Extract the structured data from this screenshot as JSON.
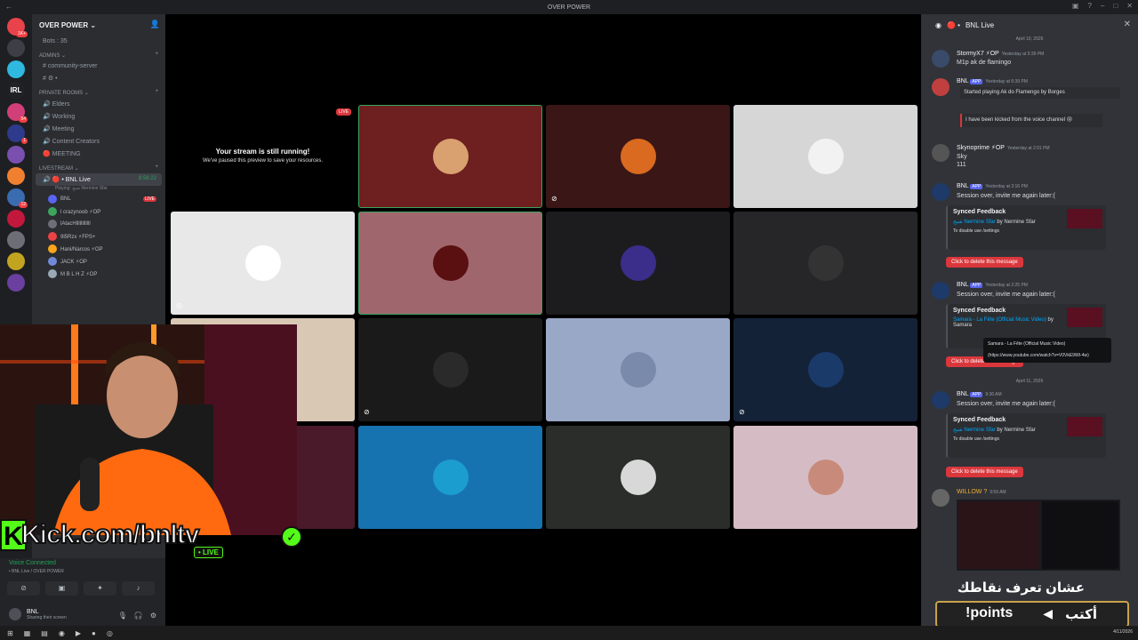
{
  "window": {
    "title": "OVER POWER"
  },
  "servers": [
    {
      "color": "#e8434b",
      "badge": "1K+"
    },
    {
      "color": "#3c3f45",
      "badge": ""
    },
    {
      "color": "#2fb8e0",
      "badge": ""
    },
    {
      "color": "#202225",
      "label": "IRL",
      "badge": ""
    },
    {
      "color": "#d13f7a",
      "badge": "54"
    },
    {
      "color": "#2e3a8c",
      "badge": "1"
    },
    {
      "color": "#7a4fb0",
      "badge": ""
    },
    {
      "color": "#f08030",
      "badge": ""
    },
    {
      "color": "#3a6cb0",
      "badge": "12"
    },
    {
      "color": "#c2183c",
      "badge": ""
    },
    {
      "color": "#6d6f78",
      "badge": ""
    },
    {
      "color": "#c2a420",
      "badge": ""
    },
    {
      "color": "#6a3fa0",
      "badge": ""
    }
  ],
  "sidebar": {
    "server_name": "OVER POWER",
    "bots_line": "Bots : 35",
    "admins_label": "ADMINS",
    "admins": [
      "community-server",
      "⚙ •"
    ],
    "private_label": "PRIVATE ROOMS",
    "private_rooms": [
      "Elders",
      "Working",
      "Meeting",
      "Content Creators",
      "MEETING"
    ],
    "livestream_label": "LIVESTREAM",
    "active_channel": "BNL Live",
    "active_time": "8:56:22",
    "active_sub": "Playing: شبح Nermine Sfar",
    "voice_users": [
      {
        "name": "BNL",
        "live": "LIVE",
        "color": "#5865f2"
      },
      {
        "name": "l crazynoob ⚡OP",
        "live": "",
        "color": "#3ba55d"
      },
      {
        "name": "lAtacHllllllllllll",
        "live": "",
        "color": "#6d6f78"
      },
      {
        "name": "9l5Rzx ⚡FPS+",
        "live": "",
        "color": "#ed4245"
      },
      {
        "name": "Hani/Narcos ⚡OP",
        "live": "",
        "color": "#faa61a"
      },
      {
        "name": "JACK ⚡OP",
        "live": "",
        "color": "#7289da"
      },
      {
        "name": "M B L H Z ⚡OP",
        "live": "",
        "color": "#99aab5"
      }
    ]
  },
  "voice_panel": {
    "status": "Voice Connected",
    "sub": "• BNL Live / OVER POWER",
    "user_name": "BNL",
    "user_status": "Sharing their screen"
  },
  "stage": {
    "live_badge": "LIVE",
    "paused_title": "Your stream is still running!",
    "paused_sub": "We've paused this preview to save your resources.",
    "tiles": [
      {
        "bg": "#6e1f1f",
        "avatar": "#d9a070",
        "border": "#3ba55d"
      },
      {
        "bg": "#3a1616",
        "avatar": "#d96a20",
        "border": ""
      },
      {
        "bg": "#d6d6d6",
        "avatar": "#f2f2f2",
        "border": ""
      },
      {
        "bg": "#e8e8e8",
        "avatar": "#ffffff",
        "border": ""
      },
      {
        "bg": "#a0666e",
        "avatar": "#5a1010",
        "border": "#3ba55d"
      },
      {
        "bg": "#1c1c1f",
        "avatar": "#3b2d8a",
        "border": ""
      },
      {
        "bg": "#262628",
        "avatar": "#333",
        "border": ""
      },
      {
        "bg": "#d9c8b4",
        "avatar": "",
        "border": ""
      },
      {
        "bg": "#1a1a1a",
        "avatar": "#2a2a2a",
        "border": ""
      },
      {
        "bg": "#9aa8c8",
        "avatar": "#7a8aaa",
        "border": ""
      },
      {
        "bg": "#142238",
        "avatar": "#1a3a6a",
        "border": ""
      },
      {
        "bg": "#4a1a2a",
        "avatar": "",
        "border": ""
      },
      {
        "bg": "#1773b0",
        "avatar": "#1b9dd0",
        "border": ""
      },
      {
        "bg": "#2a2d2a",
        "avatar": "#d8d8d8",
        "border": ""
      },
      {
        "bg": "#d5bcc4",
        "avatar": "#c88a7a",
        "border": ""
      }
    ]
  },
  "overlay": {
    "kick_url": "Kick.com/bnltv",
    "kick_live": "• LIVE",
    "points_arabic_top": "عشان تعرف نقاطك",
    "points_cmd": "!points",
    "points_arabic_write": "أكتب"
  },
  "chat": {
    "header": "BNL Live",
    "dates": [
      "April 10, 2026",
      "April 11, 2026"
    ],
    "messages": [
      {
        "name": "StormyX7",
        "tag": "⚡OP",
        "time": "Yesterday at 5:39 PM",
        "text": "M1p ak de flamingo",
        "avatar": "#3a4a6a"
      },
      {
        "name": "BNL",
        "tag": "APP",
        "time": "Yesterday at 6:39 PM",
        "text": "Started playing Ak do Flamengo by Borges",
        "avatar": "#c04040"
      },
      {
        "name": "",
        "tag": "",
        "time": "",
        "text": "I have been kicked from the voice channel 😢",
        "avatar": ""
      },
      {
        "name": "Skynoprime",
        "tag": "⚡OP",
        "time": "Yesterday at 2:01 PM",
        "text": "Sky\n111",
        "avatar": "#555"
      },
      {
        "name": "BNL",
        "tag": "APP",
        "time": "Yesterday at 2:16 PM",
        "text": "Session over, invite me again later:(",
        "avatar": "#3070c0"
      },
      {
        "name": "BNL",
        "tag": "APP",
        "time": "Yesterday at 2:25 PM",
        "text": "Session over, invite me again later:(",
        "avatar": "#3070c0"
      },
      {
        "name": "BNL",
        "tag": "APP",
        "time": "9:36 AM",
        "text": "Session over, invite me again later:(",
        "avatar": "#3070c0"
      },
      {
        "name": "WILLOW ?",
        "tag": "",
        "time": "9:59 AM",
        "text": "",
        "avatar": "#666"
      }
    ],
    "embed_title": "Synced Feedback",
    "embed_song1": "شبح Nermine Sfar",
    "embed_by1": "by Nermine Sfar",
    "embed_song2": "Samara - La Fête (Official Music Video)",
    "embed_by2": "by Samara",
    "embed_footer": "To disable use /settings",
    "delete_label": "Click to delete this message",
    "tooltip_title": "Samara - La Fête (Official Music Video)",
    "tooltip_url": "(https://www.youtube.com/watch?v=V0VkE9Wt-4w)"
  },
  "taskbar": {
    "date": "4/11/2026"
  }
}
